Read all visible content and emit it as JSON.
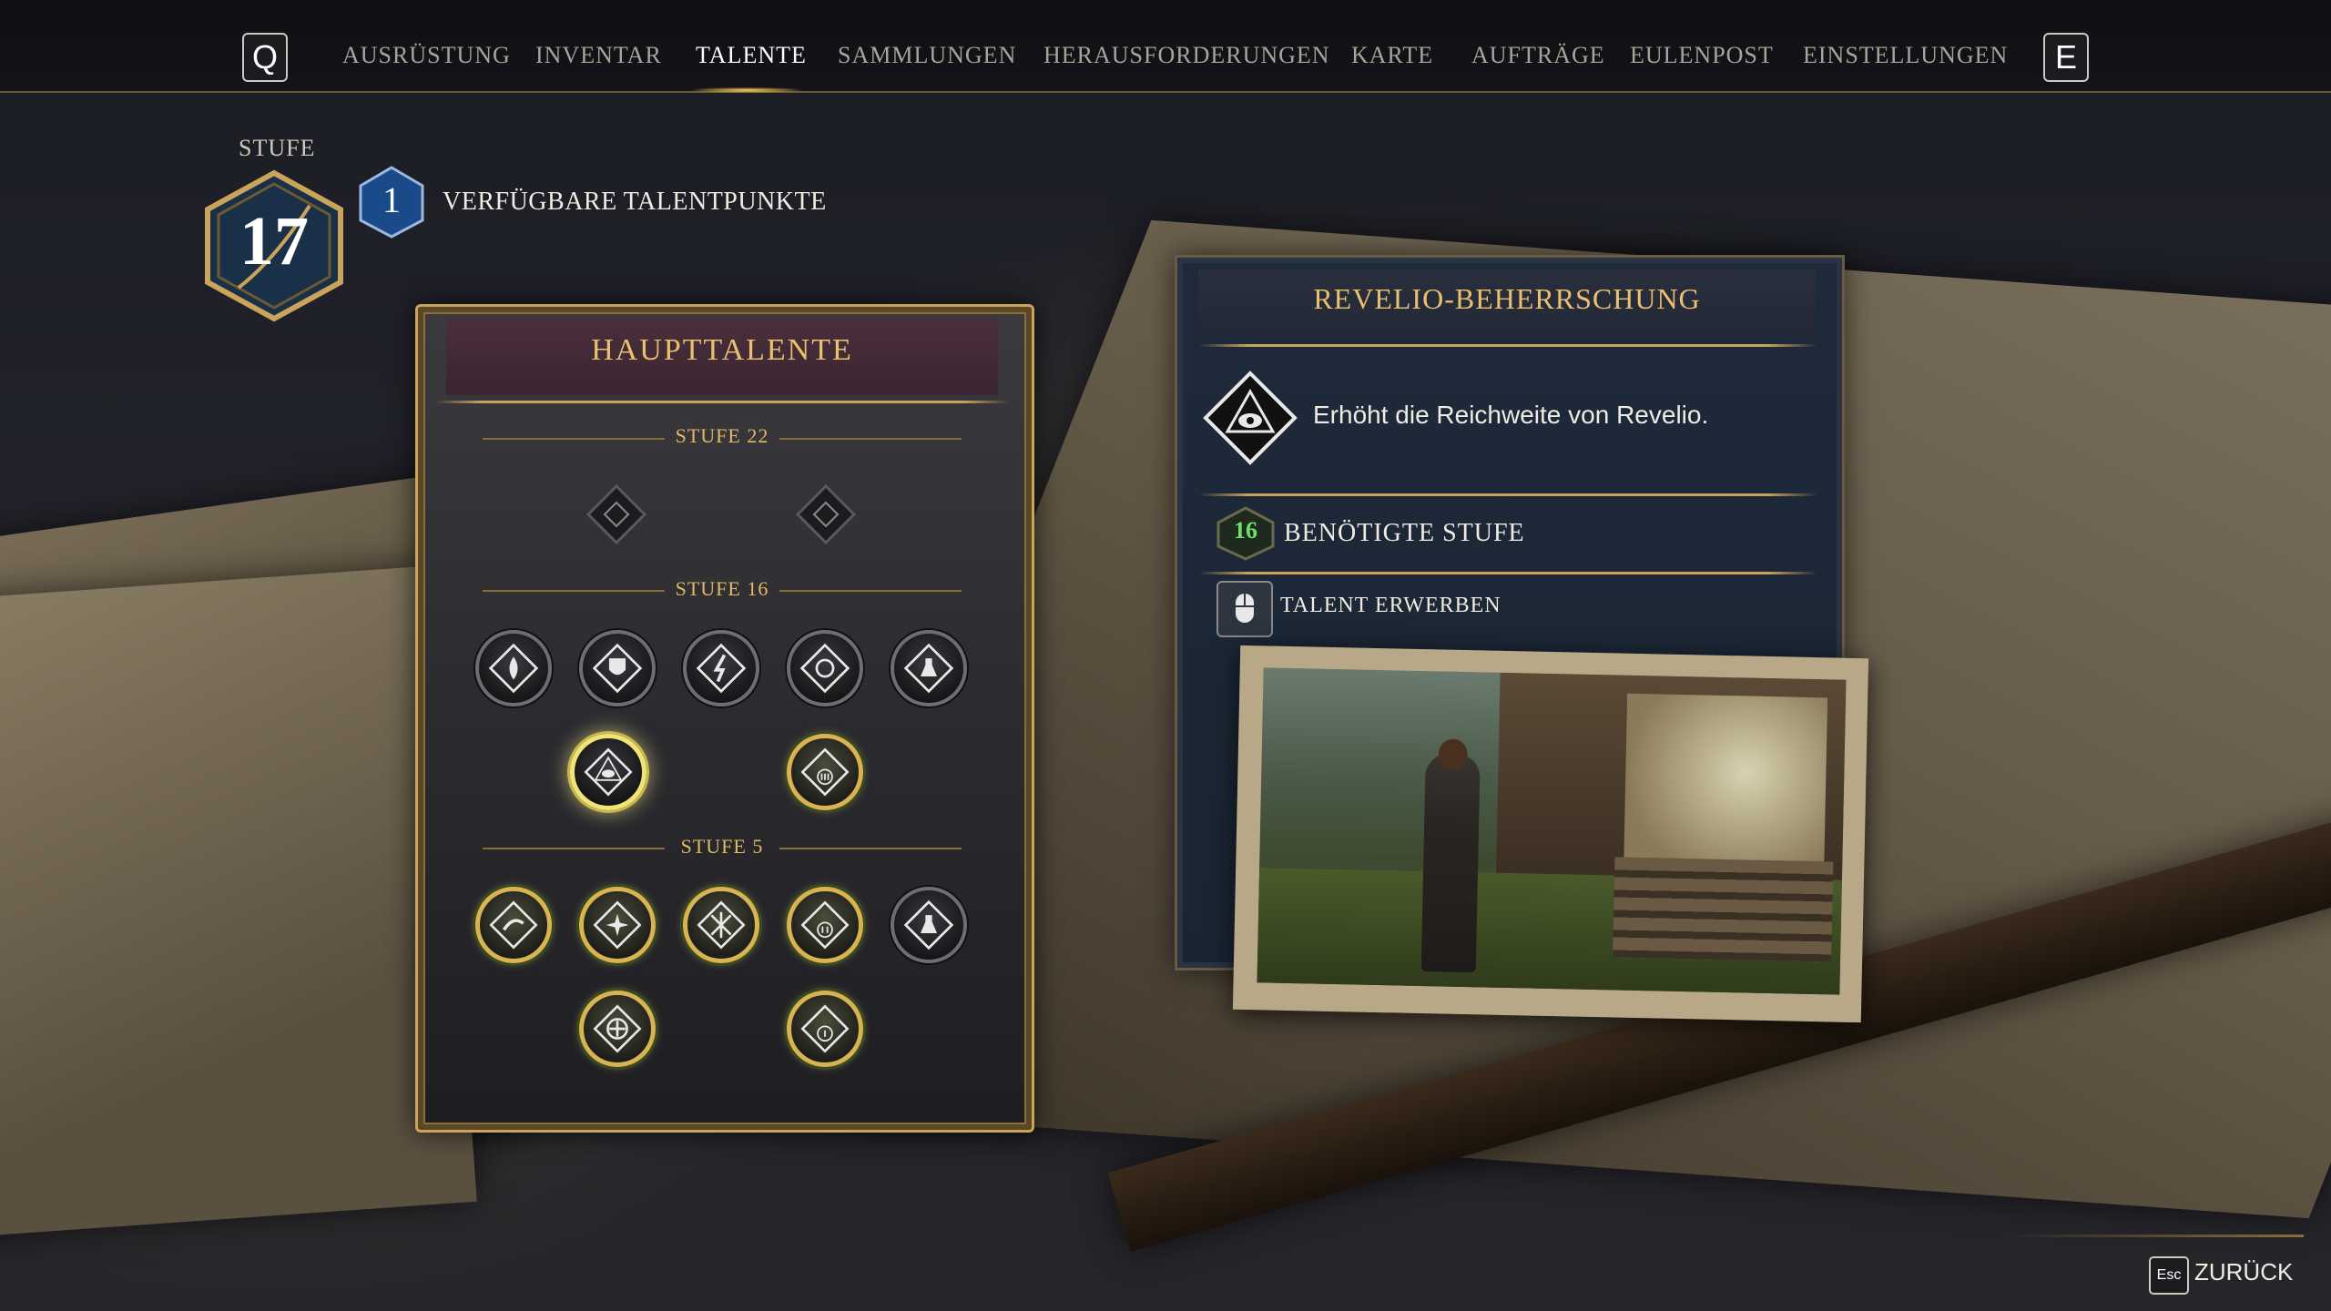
{
  "nav": {
    "left_key": "Q",
    "right_key": "E",
    "tabs": [
      {
        "label": "AUSRÜSTUNG",
        "active": false
      },
      {
        "label": "INVENTAR",
        "active": false
      },
      {
        "label": "TALENTE",
        "active": true
      },
      {
        "label": "SAMMLUNGEN",
        "active": false
      },
      {
        "label": "HERAUSFORDERUNGEN",
        "active": false
      },
      {
        "label": "KARTE",
        "active": false
      },
      {
        "label": "AUFTRÄGE",
        "active": false
      },
      {
        "label": "EULENPOST",
        "active": false
      },
      {
        "label": "EINSTELLUNGEN",
        "active": false
      }
    ]
  },
  "player": {
    "level_label": "STUFE",
    "level": "17",
    "talent_points": "1",
    "talent_points_label": "VERFÜGBARE TALENTPUNKTE"
  },
  "talent_panel": {
    "title": "HAUPTTALENTE",
    "tiers": [
      {
        "label": "STUFE 22"
      },
      {
        "label": "STUFE 16"
      },
      {
        "label": "STUFE 5"
      }
    ],
    "nodes": [
      {
        "tier": "STUFE 22",
        "icon": "dark-sigil-icon",
        "state": "locked-small"
      },
      {
        "tier": "STUFE 22",
        "icon": "dark-sigil-icon",
        "state": "locked-small"
      },
      {
        "tier": "STUFE 16",
        "icon": "spell-flame-icon",
        "state": "locked"
      },
      {
        "tier": "STUFE 16",
        "icon": "shield-rune-icon",
        "state": "locked"
      },
      {
        "tier": "STUFE 16",
        "icon": "shield-bolt-icon",
        "state": "locked"
      },
      {
        "tier": "STUFE 16",
        "icon": "beast-rune-icon",
        "state": "locked"
      },
      {
        "tier": "STUFE 16",
        "icon": "potion-diamond-icon",
        "state": "locked"
      },
      {
        "tier": "STUFE 16",
        "icon": "revelio-eye-icon",
        "state": "selected"
      },
      {
        "tier": "STUFE 16",
        "icon": "diamond-three-icon",
        "state": "unlocked"
      },
      {
        "tier": "STUFE 5",
        "icon": "hand-spell-icon",
        "state": "unlocked"
      },
      {
        "tier": "STUFE 5",
        "icon": "sparkle-diamond-icon",
        "state": "unlocked"
      },
      {
        "tier": "STUFE 5",
        "icon": "star-burst-icon",
        "state": "unlocked"
      },
      {
        "tier": "STUFE 5",
        "icon": "diamond-two-icon",
        "state": "unlocked"
      },
      {
        "tier": "STUFE 5",
        "icon": "potion-diamond-icon",
        "state": "locked"
      },
      {
        "tier": "STUFE 5",
        "icon": "plus-cross-icon",
        "state": "unlocked"
      },
      {
        "tier": "STUFE 5",
        "icon": "diamond-one-icon",
        "state": "unlocked"
      }
    ]
  },
  "detail": {
    "title": "REVELIO-BEHERRSCHUNG",
    "description": "Erhöht die Reichweite von Revelio.",
    "required_level": "16",
    "required_label": "BENÖTIGTE STUFE",
    "action_label": "TALENT ERWERBEN"
  },
  "footer": {
    "back_key": "Esc",
    "back_label": "ZURÜCK"
  },
  "colors": {
    "gold": "#c9a45a",
    "title_gold": "#e8c070",
    "required_green": "#6ee06a",
    "selected_glow": "#f2e27a"
  }
}
